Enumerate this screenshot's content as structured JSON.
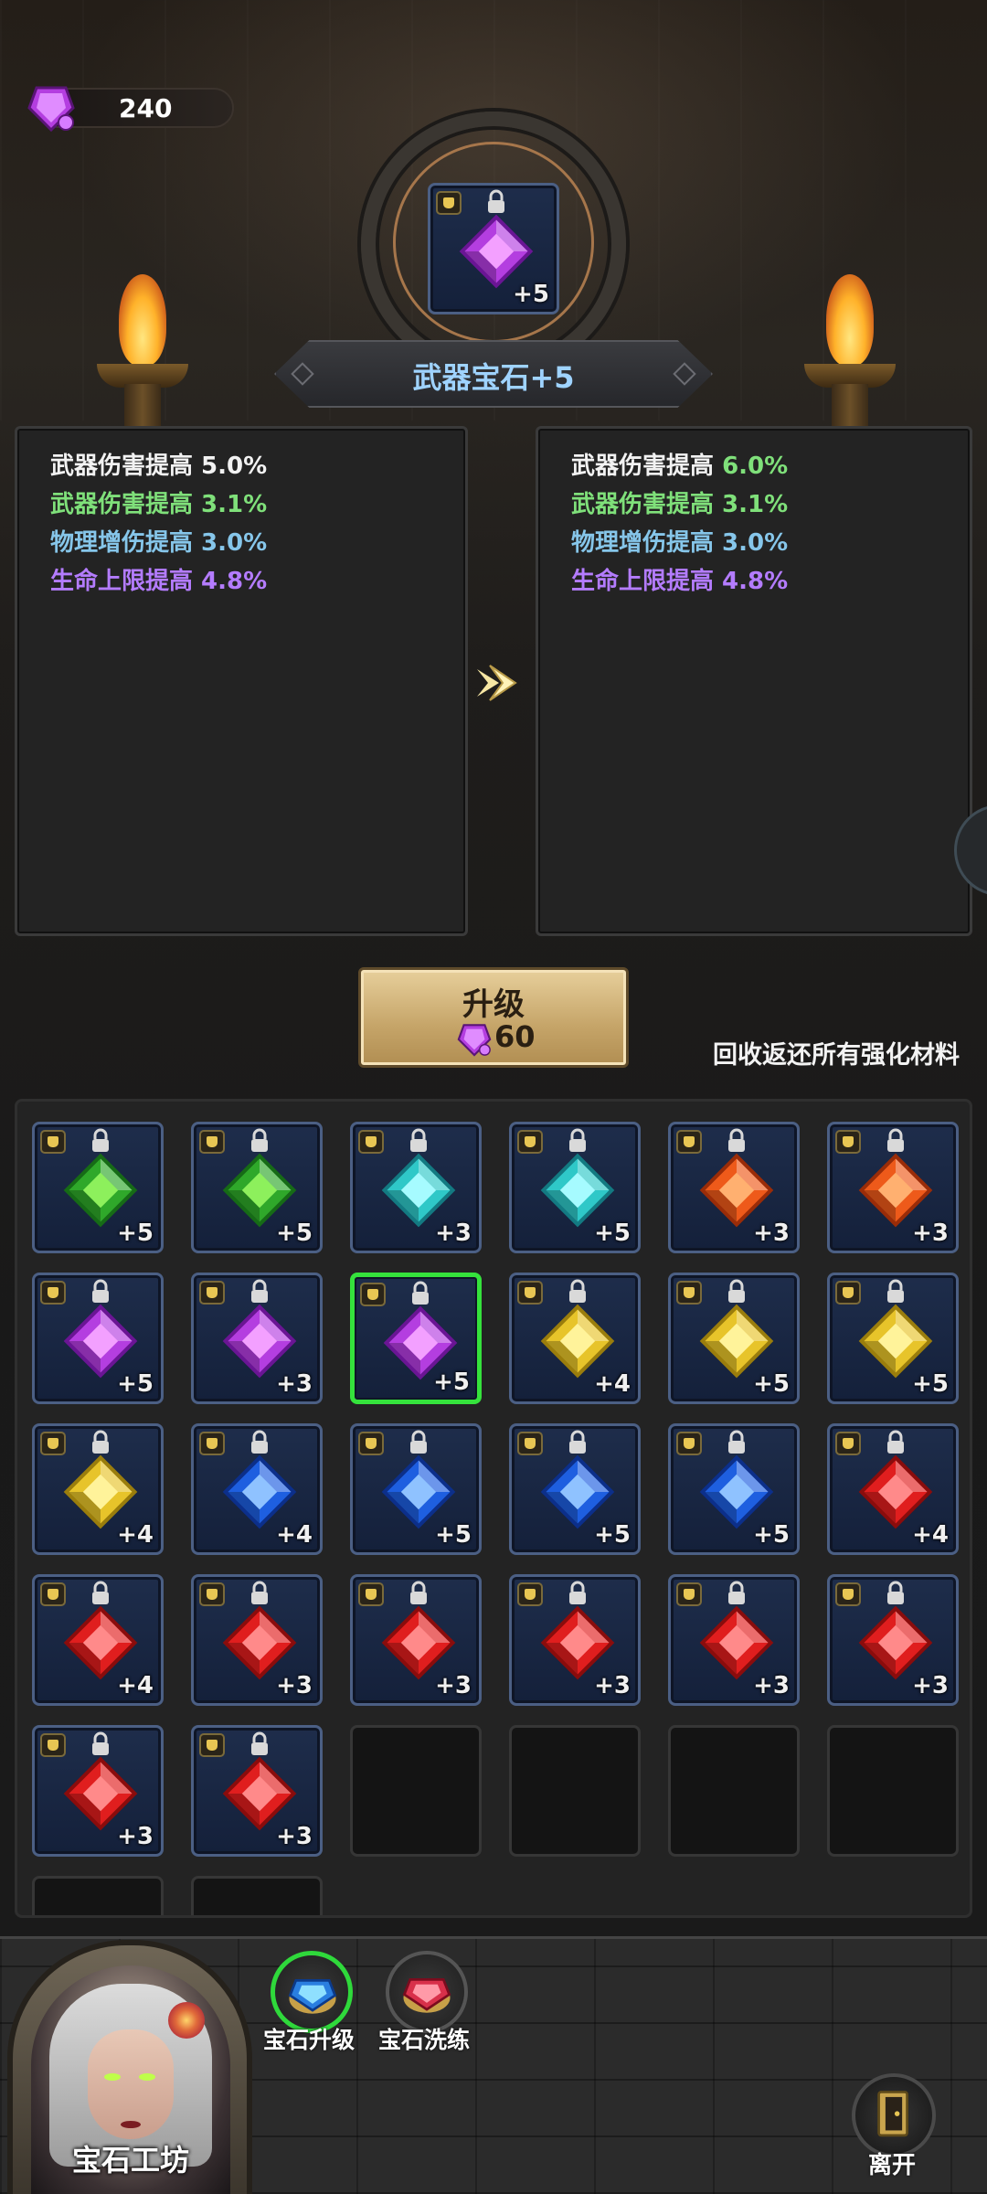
{
  "currency": {
    "value": "240",
    "icon": "purple-gem-icon"
  },
  "featured": {
    "level": "+5",
    "gem_color": "#b43ee0",
    "title": "武器宝石+5"
  },
  "current_stats": [
    {
      "label": "武器伤害提高 5.0%",
      "tone": "white"
    },
    {
      "label": "武器伤害提高 3.1%",
      "tone": "green"
    },
    {
      "label": "物理增伤提高 3.0%",
      "tone": "blue"
    },
    {
      "label": "生命上限提高 4.8%",
      "tone": "purple"
    }
  ],
  "next_stats": [
    {
      "label_main": "武器伤害提高",
      "label_value": "6.0%",
      "tone": "white"
    },
    {
      "label_main": "武器伤害提高 3.1%",
      "tone": "green"
    },
    {
      "label_main": "物理增伤提高 3.0%",
      "tone": "blue"
    },
    {
      "label_main": "生命上限提高 4.8%",
      "tone": "purple"
    }
  ],
  "upgrade_button": {
    "label": "升级",
    "cost": "60"
  },
  "recycle_text": "回收返还所有强化材料",
  "inventory": [
    {
      "color": "green",
      "level": "+5"
    },
    {
      "color": "green",
      "level": "+5"
    },
    {
      "color": "cyan",
      "level": "+3"
    },
    {
      "color": "cyan",
      "level": "+5"
    },
    {
      "color": "orange",
      "level": "+3"
    },
    {
      "color": "orange",
      "level": "+3"
    },
    {
      "color": "purple",
      "level": "+5"
    },
    {
      "color": "purple",
      "level": "+3"
    },
    {
      "color": "purple",
      "level": "+5",
      "selected": true
    },
    {
      "color": "yellow",
      "level": "+4"
    },
    {
      "color": "yellow",
      "level": "+5"
    },
    {
      "color": "yellow",
      "level": "+5"
    },
    {
      "color": "yellow",
      "level": "+4"
    },
    {
      "color": "blue",
      "level": "+4"
    },
    {
      "color": "blue",
      "level": "+5"
    },
    {
      "color": "blue",
      "level": "+5"
    },
    {
      "color": "blue",
      "level": "+5"
    },
    {
      "color": "red",
      "level": "+4"
    },
    {
      "color": "red",
      "level": "+4"
    },
    {
      "color": "red",
      "level": "+3"
    },
    {
      "color": "red",
      "level": "+3"
    },
    {
      "color": "red",
      "level": "+3"
    },
    {
      "color": "red",
      "level": "+3"
    },
    {
      "color": "red",
      "level": "+3"
    },
    {
      "color": "red",
      "level": "+3"
    },
    {
      "color": "red",
      "level": "+3"
    },
    {
      "empty": true
    },
    {
      "empty": true
    },
    {
      "empty": true
    },
    {
      "empty": true
    }
  ],
  "gem_colors": {
    "green": [
      "#8df05c",
      "#2fa82a",
      "#166b16"
    ],
    "cyan": [
      "#a6fbff",
      "#2fc8c8",
      "#137a82"
    ],
    "orange": [
      "#ffb070",
      "#ee5a1a",
      "#9a2c08"
    ],
    "purple": [
      "#f3a0ff",
      "#b43ee0",
      "#6a1594"
    ],
    "yellow": [
      "#fff39a",
      "#e7c42a",
      "#9a7d0c"
    ],
    "blue": [
      "#8fc2ff",
      "#1e5fe0",
      "#0c2f8a"
    ],
    "red": [
      "#ff8a8a",
      "#e01e1e",
      "#8a0c0c"
    ]
  },
  "stat_colors": {
    "white": "#f2f2f2",
    "green": "#7fe07a",
    "blue": "#86c6ea",
    "purple": "#b47cff"
  },
  "bottom": {
    "workshop_label": "宝石工坊",
    "tabs": [
      {
        "label": "宝石升级",
        "active": true
      },
      {
        "label": "宝石洗练",
        "active": false
      }
    ],
    "leave_label": "离开"
  }
}
